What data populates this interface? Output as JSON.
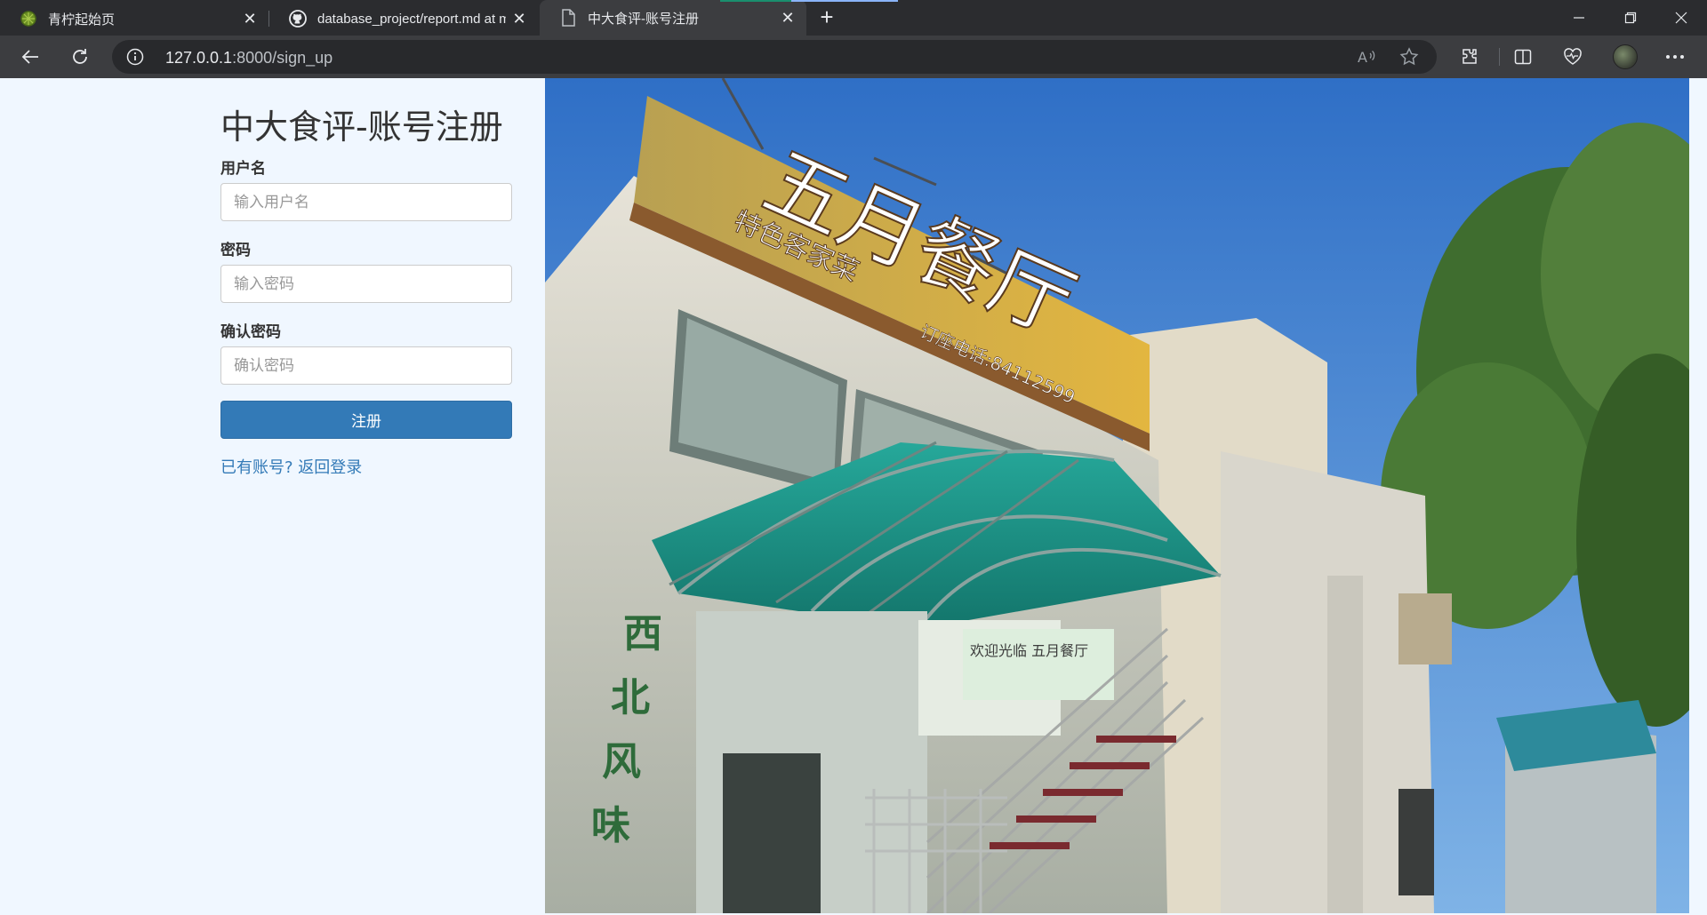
{
  "browser": {
    "tabs": [
      {
        "title": "青柠起始页",
        "icon": "lime-icon",
        "active": false
      },
      {
        "title": "database_project/report.md at m",
        "icon": "github-icon",
        "active": false
      },
      {
        "title": "中大食评-账号注册",
        "icon": "page-icon",
        "active": true
      }
    ],
    "url_host": "127.0.0.1",
    "url_rest": ":8000/sign_up"
  },
  "page": {
    "title": "中大食评-账号注册",
    "username_label": "用户名",
    "username_placeholder": "输入用户名",
    "password_label": "密码",
    "password_placeholder": "输入密码",
    "confirm_label": "确认密码",
    "confirm_placeholder": "确认密码",
    "submit_label": "注册",
    "login_link": "已有账号? 返回登录"
  },
  "photo": {
    "sign_main": "五月餐厅",
    "sign_sub": "特色客家菜",
    "sign_phone": "订座电话:84112599",
    "wall_text": [
      "西",
      "北",
      "风",
      "味"
    ],
    "door_banner": "欢迎光临 五月餐厅"
  },
  "colors": {
    "page_bg": "#f0f7ff",
    "primary": "#337ab7",
    "sky": "#3b7fd0"
  }
}
